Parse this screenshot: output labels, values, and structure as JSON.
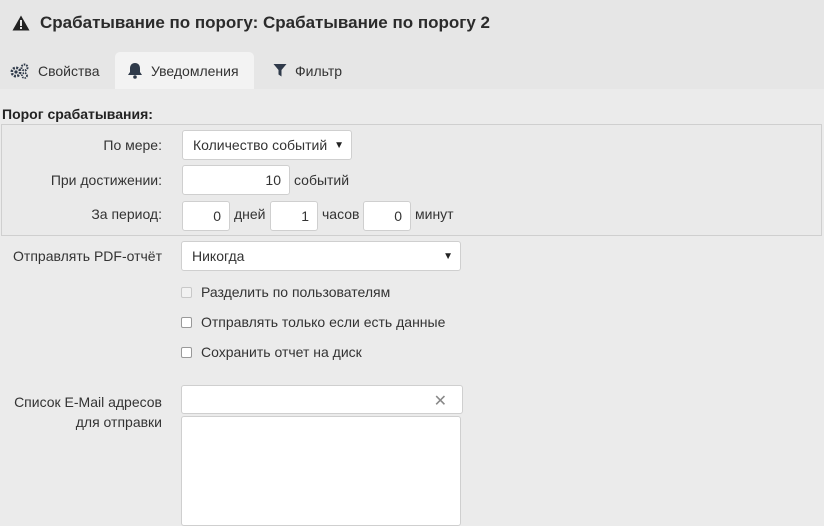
{
  "header": {
    "title": "Срабатывание по порогу: Срабатывание по порогу 2",
    "icon": "warning-icon"
  },
  "tabs": [
    {
      "label": "Свойства",
      "icon": "gears-icon",
      "active": false
    },
    {
      "label": "Уведомления",
      "icon": "bell-icon",
      "active": true
    },
    {
      "label": "Фильтр",
      "icon": "filter-icon",
      "active": false
    }
  ],
  "threshold": {
    "section_label": "Порог срабатывания:",
    "measure_label": "По мере:",
    "measure_value": "Количество событий",
    "reach_label": "При достижении:",
    "reach_value": "10",
    "reach_unit": "событий",
    "period_label": "За период:",
    "days_value": "0",
    "days_unit": "дней",
    "hours_value": "1",
    "hours_unit": "часов",
    "minutes_value": "0",
    "minutes_unit": "минут"
  },
  "pdf": {
    "label": "Отправлять PDF-отчёт",
    "value": "Никогда"
  },
  "checkboxes": [
    {
      "label": "Разделить по пользователям",
      "checked": false,
      "disabled": true
    },
    {
      "label": "Отправлять только если есть данные",
      "checked": false,
      "disabled": false
    },
    {
      "label": "Сохранить отчет на диск",
      "checked": false,
      "disabled": false
    }
  ],
  "email": {
    "label_line1": "Список E-Mail адресов",
    "label_line2": "для отправки",
    "value": "",
    "clear": "✕"
  }
}
